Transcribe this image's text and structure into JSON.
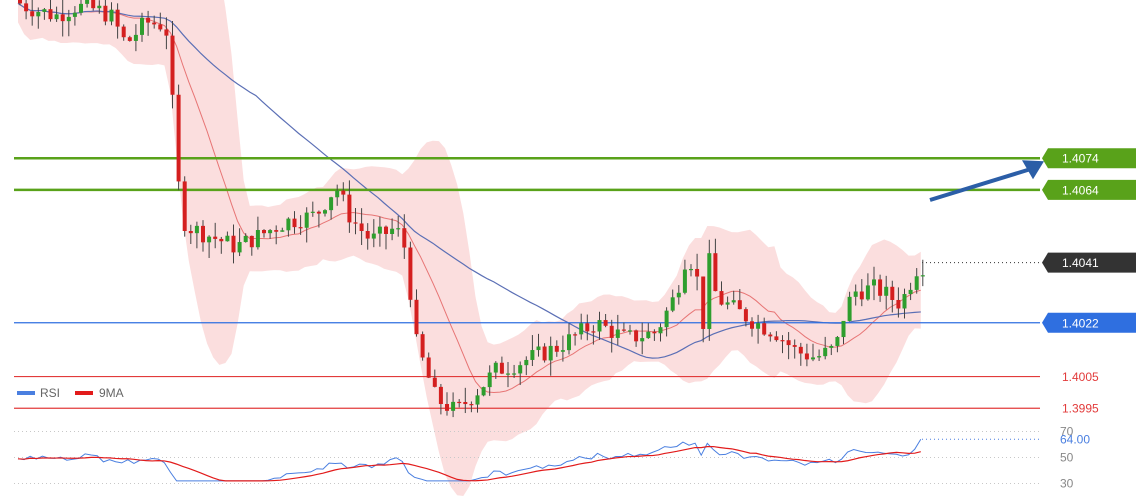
{
  "chart_data": [
    {
      "type": "candlestick",
      "ylim": [
        1.3966,
        1.4124
      ],
      "grid": false,
      "trend_arrow": {
        "color": "#2b5ea7",
        "direction": "up"
      },
      "levels": [
        {
          "label": "1.4074",
          "value": 1.4074,
          "role": "resistance",
          "color": "#59a21a",
          "label_color": "#ffffff",
          "label_bg": "#59a21a"
        },
        {
          "label": "1.4064",
          "value": 1.4064,
          "role": "resistance",
          "color": "#59a21a",
          "label_color": "#ffffff",
          "label_bg": "#59a21a"
        },
        {
          "label": "1.4041",
          "value": 1.4041,
          "role": "current",
          "color": "#333333",
          "label_color": "#ffffff",
          "label_bg": "#333333"
        },
        {
          "label": "1.4022",
          "value": 1.4022,
          "role": "pivot",
          "color": "#2f6fe0",
          "label_color": "#ffffff",
          "label_bg": "#2f6fe0"
        },
        {
          "label": "1.4005",
          "value": 1.4005,
          "role": "support",
          "color": "#e23b3b",
          "label_color": "#e23b3b",
          "label_bg": ""
        },
        {
          "label": "1.3995",
          "value": 1.3995,
          "role": "support",
          "color": "#e23b3b",
          "label_color": "#e23b3b",
          "label_bg": ""
        }
      ],
      "colors": {
        "up": "#2e9e2e",
        "down": "#d41f1f",
        "band": "#f9d3d3",
        "ma_fast": "#e25a5a",
        "ma_slow": "#5b6fb5"
      }
    },
    {
      "type": "line",
      "ylim": [
        25,
        75
      ],
      "yticks": [
        30,
        50,
        70
      ],
      "current_value_label": "64.00",
      "series": [
        {
          "name": "RSI",
          "color": "#4a7fe0"
        },
        {
          "name": "9MA",
          "color": "#e21b1b"
        }
      ]
    }
  ]
}
